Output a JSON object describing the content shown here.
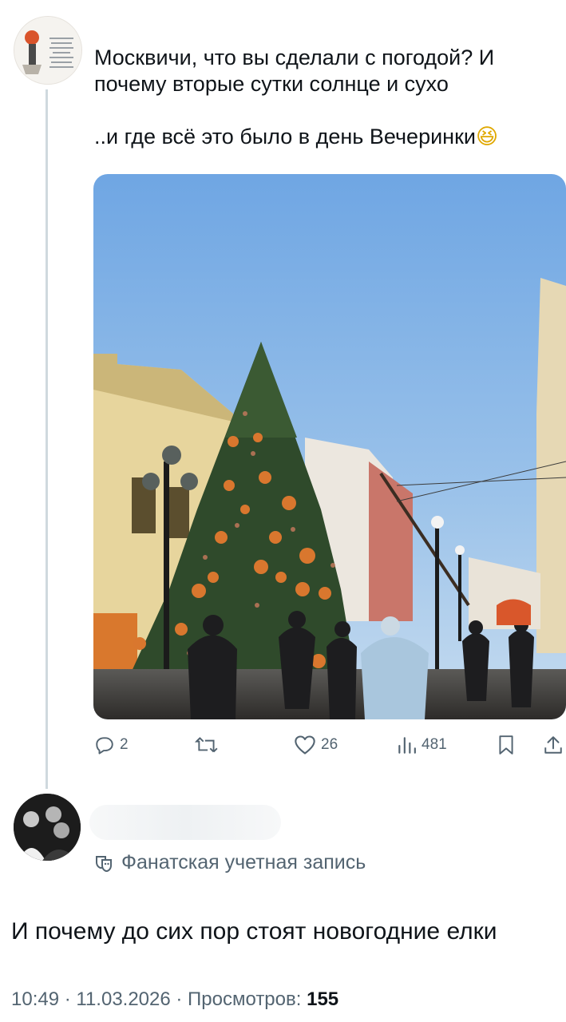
{
  "tweet": {
    "line1": "Москвичи, что вы сделали с погодой? И",
    "line2": "почему вторые сутки солнце и сухо",
    "line3": "..и где всё это было в день Вечеринки",
    "emoji": "😆",
    "photo_alt": "Новогодняя ёлка на пешеходной улице в солнечный день",
    "actions": {
      "replies": "2",
      "reposts": "",
      "likes": "26",
      "views": "481"
    }
  },
  "reply": {
    "badge_label": "Фанатская учетная запись",
    "text": "И почему до сих пор стоят новогодние  елки",
    "time": "10:49 · 11.03.2026 · Просмотров: ",
    "views": "155"
  },
  "icons": [
    "avatar",
    "reply-icon",
    "repost-icon",
    "like-icon",
    "views-icon",
    "bookmark-icon",
    "share-icon",
    "theater-masks-icon"
  ],
  "colors": {
    "text": "#0f1419",
    "secondary": "#536471",
    "thread_line": "#cfd9de",
    "sky": "#7fb0e4"
  }
}
